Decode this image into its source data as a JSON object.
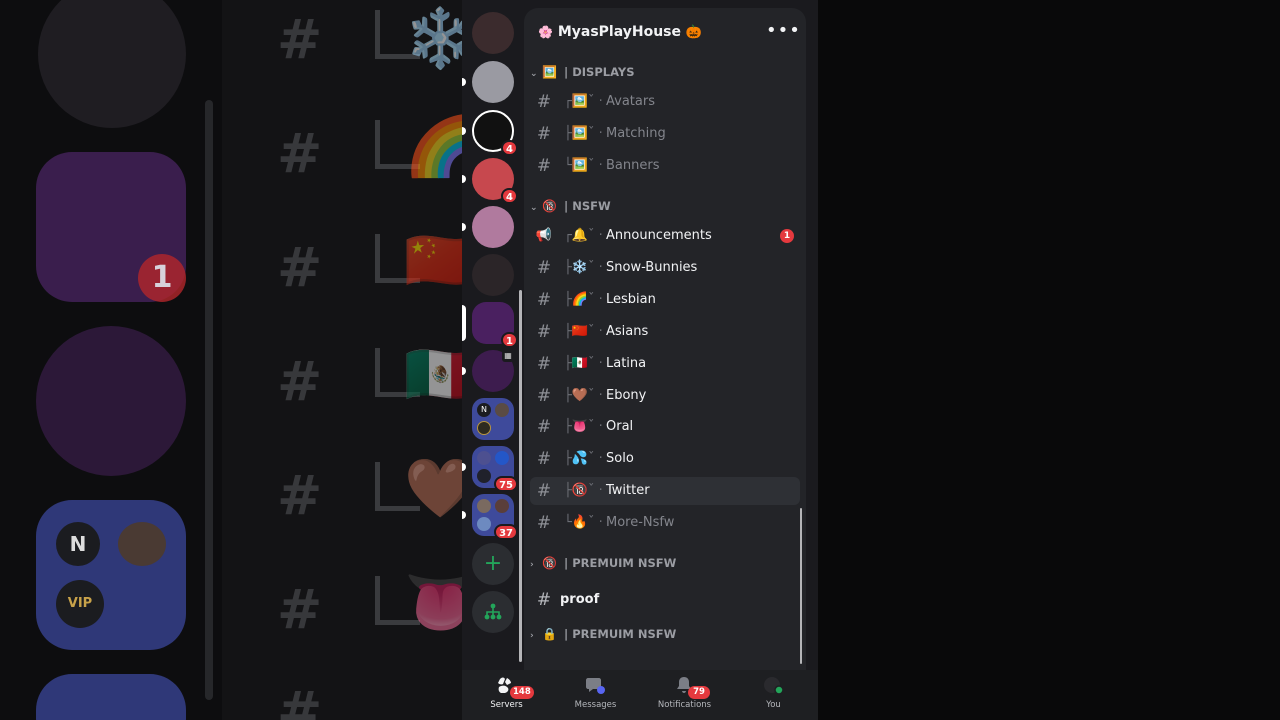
{
  "server": {
    "name": "MyasPlayHouse",
    "name_prefix_emoji": "🌸",
    "name_suffix_emoji": "🎃",
    "more_label": "•••"
  },
  "server_list": {
    "badges": [
      "4",
      "4",
      "1",
      "75",
      "37"
    ],
    "add_label": "+",
    "folder_initial": "N"
  },
  "categories": [
    {
      "name": "DISPLAYS",
      "emoji": "🖼️",
      "separator": "|",
      "expanded": true,
      "channels": [
        {
          "deco": "┌🖼️ˇ ·",
          "name": "Avatars",
          "state": "muted"
        },
        {
          "deco": "├🖼️ˇ ·",
          "name": "Matching",
          "state": "muted"
        },
        {
          "deco": "└🖼️ˇ ·",
          "name": "Banners",
          "state": "muted"
        }
      ]
    },
    {
      "name": "NSFW",
      "emoji": "🔞",
      "separator": "|",
      "expanded": true,
      "channels": [
        {
          "deco": "┌🔔ˇ ·",
          "name": "Announcements",
          "state": "unread",
          "badge": "1",
          "type": "announcement"
        },
        {
          "deco": "├❄️ˇ ·",
          "name": "Snow-Bunnies",
          "state": "unread"
        },
        {
          "deco": "├🌈ˇ ·",
          "name": "Lesbian",
          "state": "unread"
        },
        {
          "deco": "├🇨🇳ˇ ·",
          "name": "Asians",
          "state": "unread"
        },
        {
          "deco": "├🇲🇽ˇ ·",
          "name": "Latina",
          "state": "unread"
        },
        {
          "deco": "├🤎ˇ ·",
          "name": "Ebony",
          "state": "unread"
        },
        {
          "deco": "├👅ˇ ·",
          "name": "Oral",
          "state": "unread"
        },
        {
          "deco": "├💦ˇ ·",
          "name": "Solo",
          "state": "unread"
        },
        {
          "deco": "├🔞ˇ ·",
          "name": "Twitter",
          "state": "selected"
        },
        {
          "deco": "└🔥ˇ ·",
          "name": "More-Nsfw",
          "state": "muted"
        }
      ]
    },
    {
      "name": "PREMUIM NSFW",
      "emoji": "🔞",
      "separator": "|",
      "expanded": false
    },
    {
      "name": "PREMUIM NSFW",
      "emoji": "🔒",
      "separator": "|",
      "expanded": false
    }
  ],
  "loose_channel": {
    "name": "proof"
  },
  "nav": {
    "tabs": [
      {
        "label": "Servers",
        "badge": "148",
        "active": true
      },
      {
        "label": "Messages",
        "badge": "",
        "active": false
      },
      {
        "label": "Notifications",
        "badge": "79",
        "active": false
      },
      {
        "label": "You",
        "badge": "",
        "active": false
      }
    ]
  },
  "background": {
    "badge": "1",
    "folder_initial": "N",
    "vip_label": "VIP"
  },
  "colors": {
    "accent_red": "#e5393e",
    "accent_green": "#23a55a",
    "panel": "#232428",
    "rail": "#1a1a1e"
  }
}
